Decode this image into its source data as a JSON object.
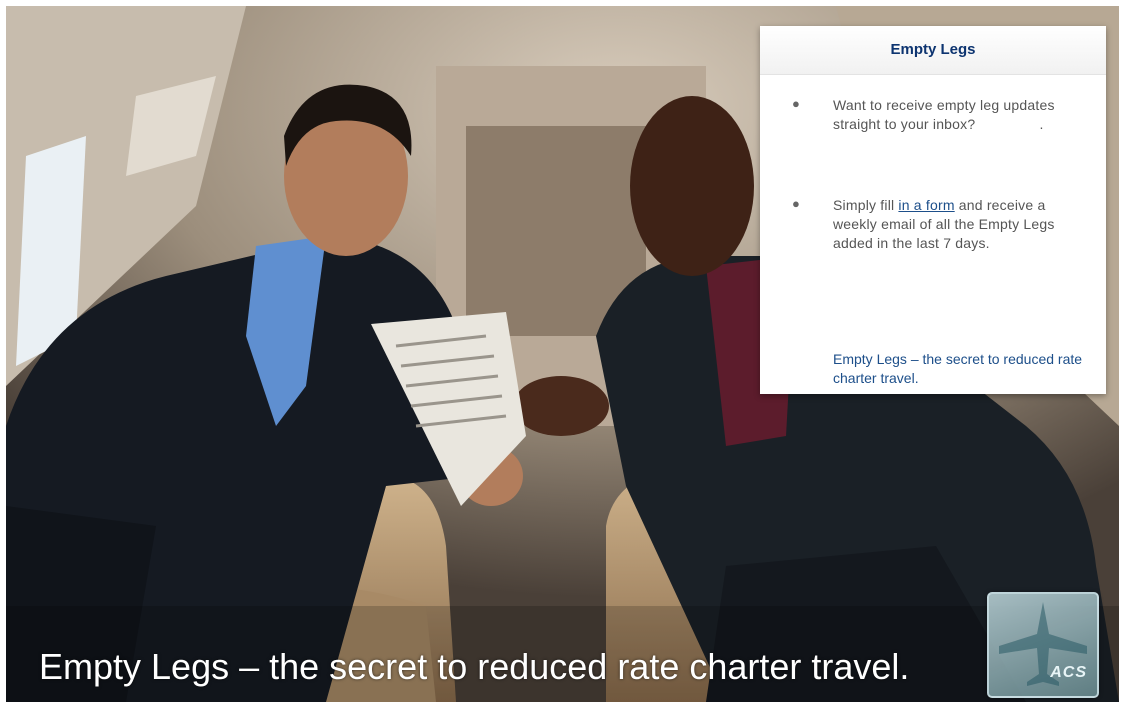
{
  "panel": {
    "title": "Empty Legs",
    "items": [
      {
        "text": "Want to receive empty leg updates straight to your inbox?",
        "trail": "."
      },
      {
        "text_before": "Simply fill ",
        "link": "in a form",
        "text_after": " and receive a weekly email of all the Empty Legs added in the last 7 days."
      }
    ],
    "tagline": "Empty Legs – the secret to reduced rate charter travel."
  },
  "caption": "Empty Legs – the secret to reduced rate charter travel.",
  "logo": {
    "text": "ACS"
  },
  "colors": {
    "title": "#0d3470",
    "link": "#1d4f8a",
    "body": "#555555"
  }
}
